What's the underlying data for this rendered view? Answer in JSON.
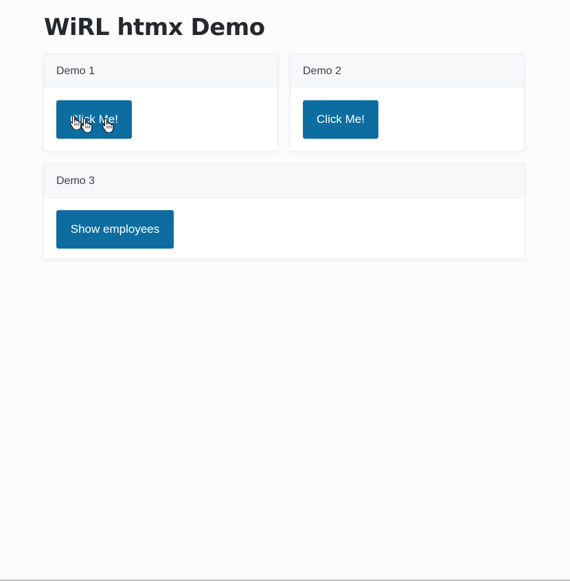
{
  "page": {
    "title": "WiRL htmx Demo"
  },
  "demos": [
    {
      "header": "Demo 1",
      "button_label": "Click Me!"
    },
    {
      "header": "Demo 2",
      "button_label": "Click Me!"
    },
    {
      "header": "Demo 3",
      "button_label": "Show employees"
    }
  ],
  "icons": {
    "cursor": "hand-pointer-icon"
  },
  "colors": {
    "button_bg": "#0d6da0",
    "button_text": "#ffffff",
    "page_bg": "#fcfcfd",
    "card_header_bg": "#f6f8f9"
  }
}
